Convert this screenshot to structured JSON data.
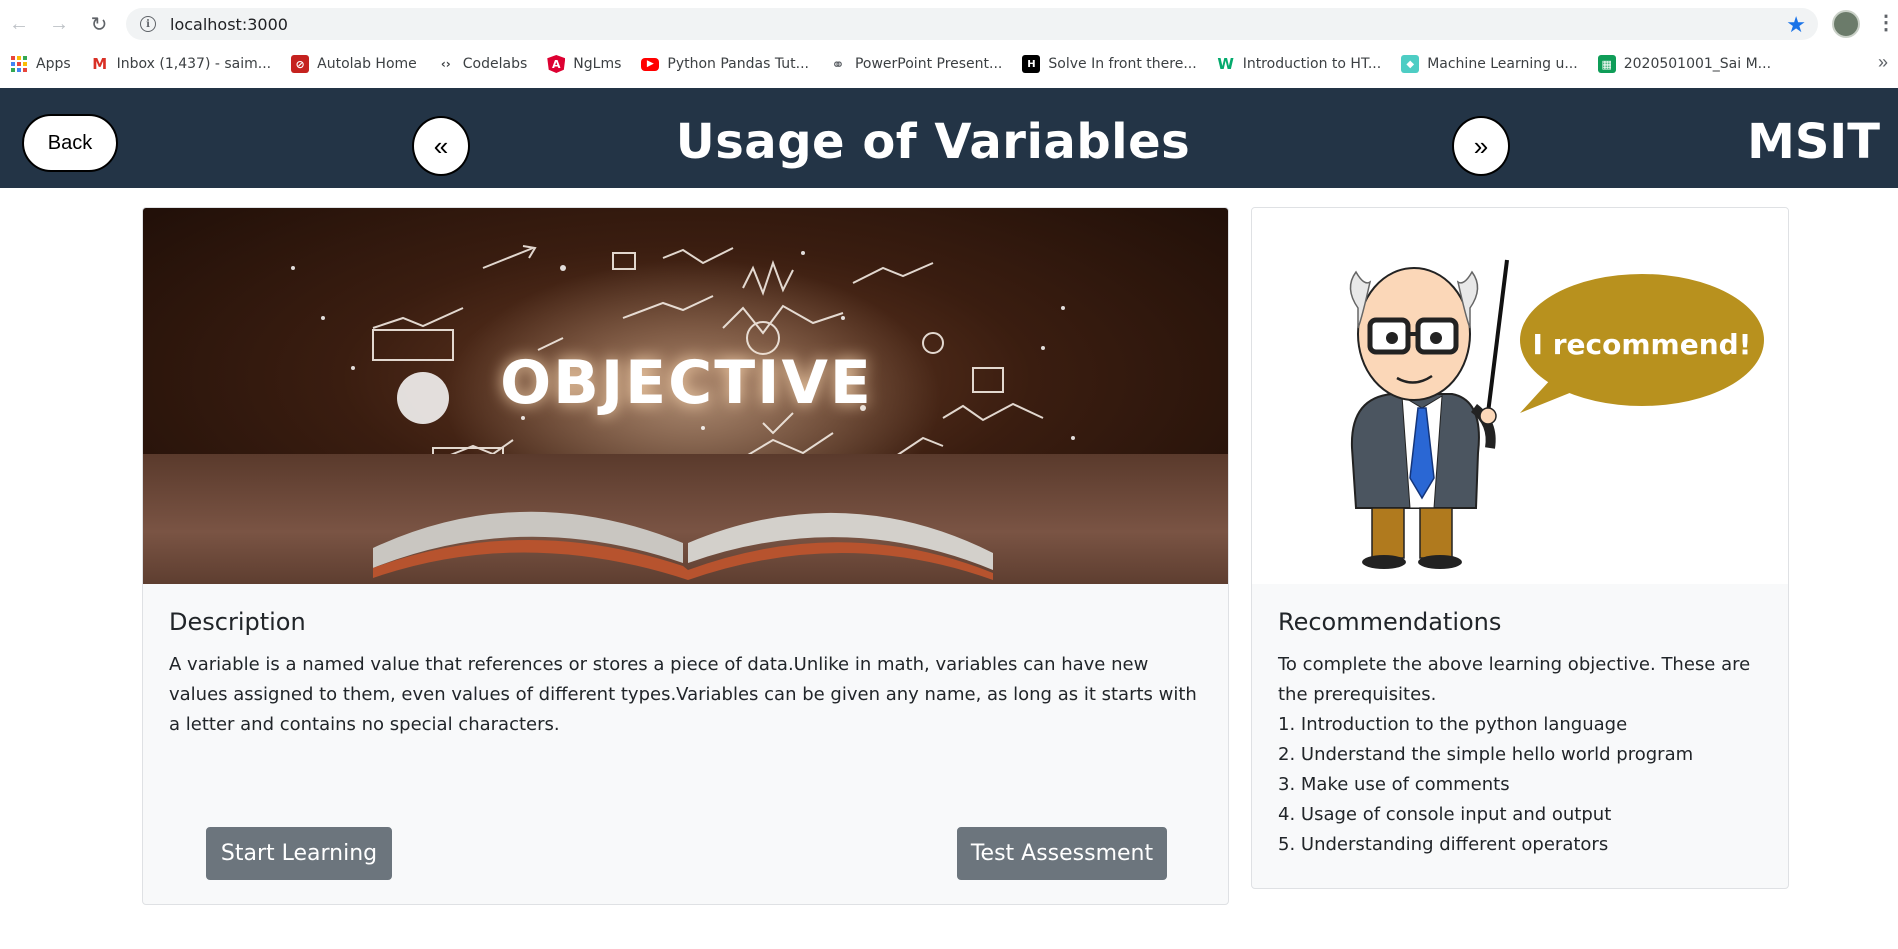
{
  "browser": {
    "url": "localhost:3000",
    "bookmarks": [
      {
        "label": "Apps",
        "icon": "apps-grid-icon",
        "color": "#e8453c"
      },
      {
        "label": "Inbox (1,437) - saim...",
        "icon": "gmail-icon",
        "color": "#d93025"
      },
      {
        "label": "Autolab Home",
        "icon": "autolab-icon",
        "color": "#c5221f"
      },
      {
        "label": "Codelabs",
        "icon": "codelabs-icon",
        "color": "#3c4043"
      },
      {
        "label": "NgLms",
        "icon": "angular-icon",
        "color": "#dd0031"
      },
      {
        "label": "Python Pandas Tut...",
        "icon": "youtube-icon",
        "color": "#ff0000"
      },
      {
        "label": "PowerPoint Present...",
        "icon": "globe-icon",
        "color": "#5f6368"
      },
      {
        "label": "Solve In front there...",
        "icon": "hackerrank-icon",
        "color": "#000000"
      },
      {
        "label": "Introduction to HT...",
        "icon": "w3schools-icon",
        "color": "#04aa6d"
      },
      {
        "label": "Machine Learning u...",
        "icon": "ml-icon",
        "color": "#4ecdc4"
      },
      {
        "label": "2020501001_Sai M...",
        "icon": "sheets-icon",
        "color": "#0f9d58"
      }
    ],
    "more": "»"
  },
  "header": {
    "back_label": "Back",
    "prev_label": "«",
    "next_label": "»",
    "title": "Usage of Variables",
    "brand": "MSIT",
    "bg_color": "#233446"
  },
  "main_card": {
    "hero_word": "OBJECTIVE",
    "title": "Description",
    "text": "A variable is a named value that references or stores a piece of data.Unlike in math, variables can have new values assigned to them, even values of different types.Variables can be given any name, as long as it starts with a letter and contains no special characters.",
    "start_label": "Start Learning",
    "test_label": "Test Assessment"
  },
  "side_card": {
    "bubble_text": "I recommend!",
    "title": "Recommendations",
    "intro": "To complete the above learning objective. These are the prerequisites.",
    "items": [
      "1. Introduction to the python language",
      "2. Understand the simple hello world program",
      "3. Make use of comments",
      "4. Usage of console input and output",
      "5. Understanding different operators"
    ]
  }
}
